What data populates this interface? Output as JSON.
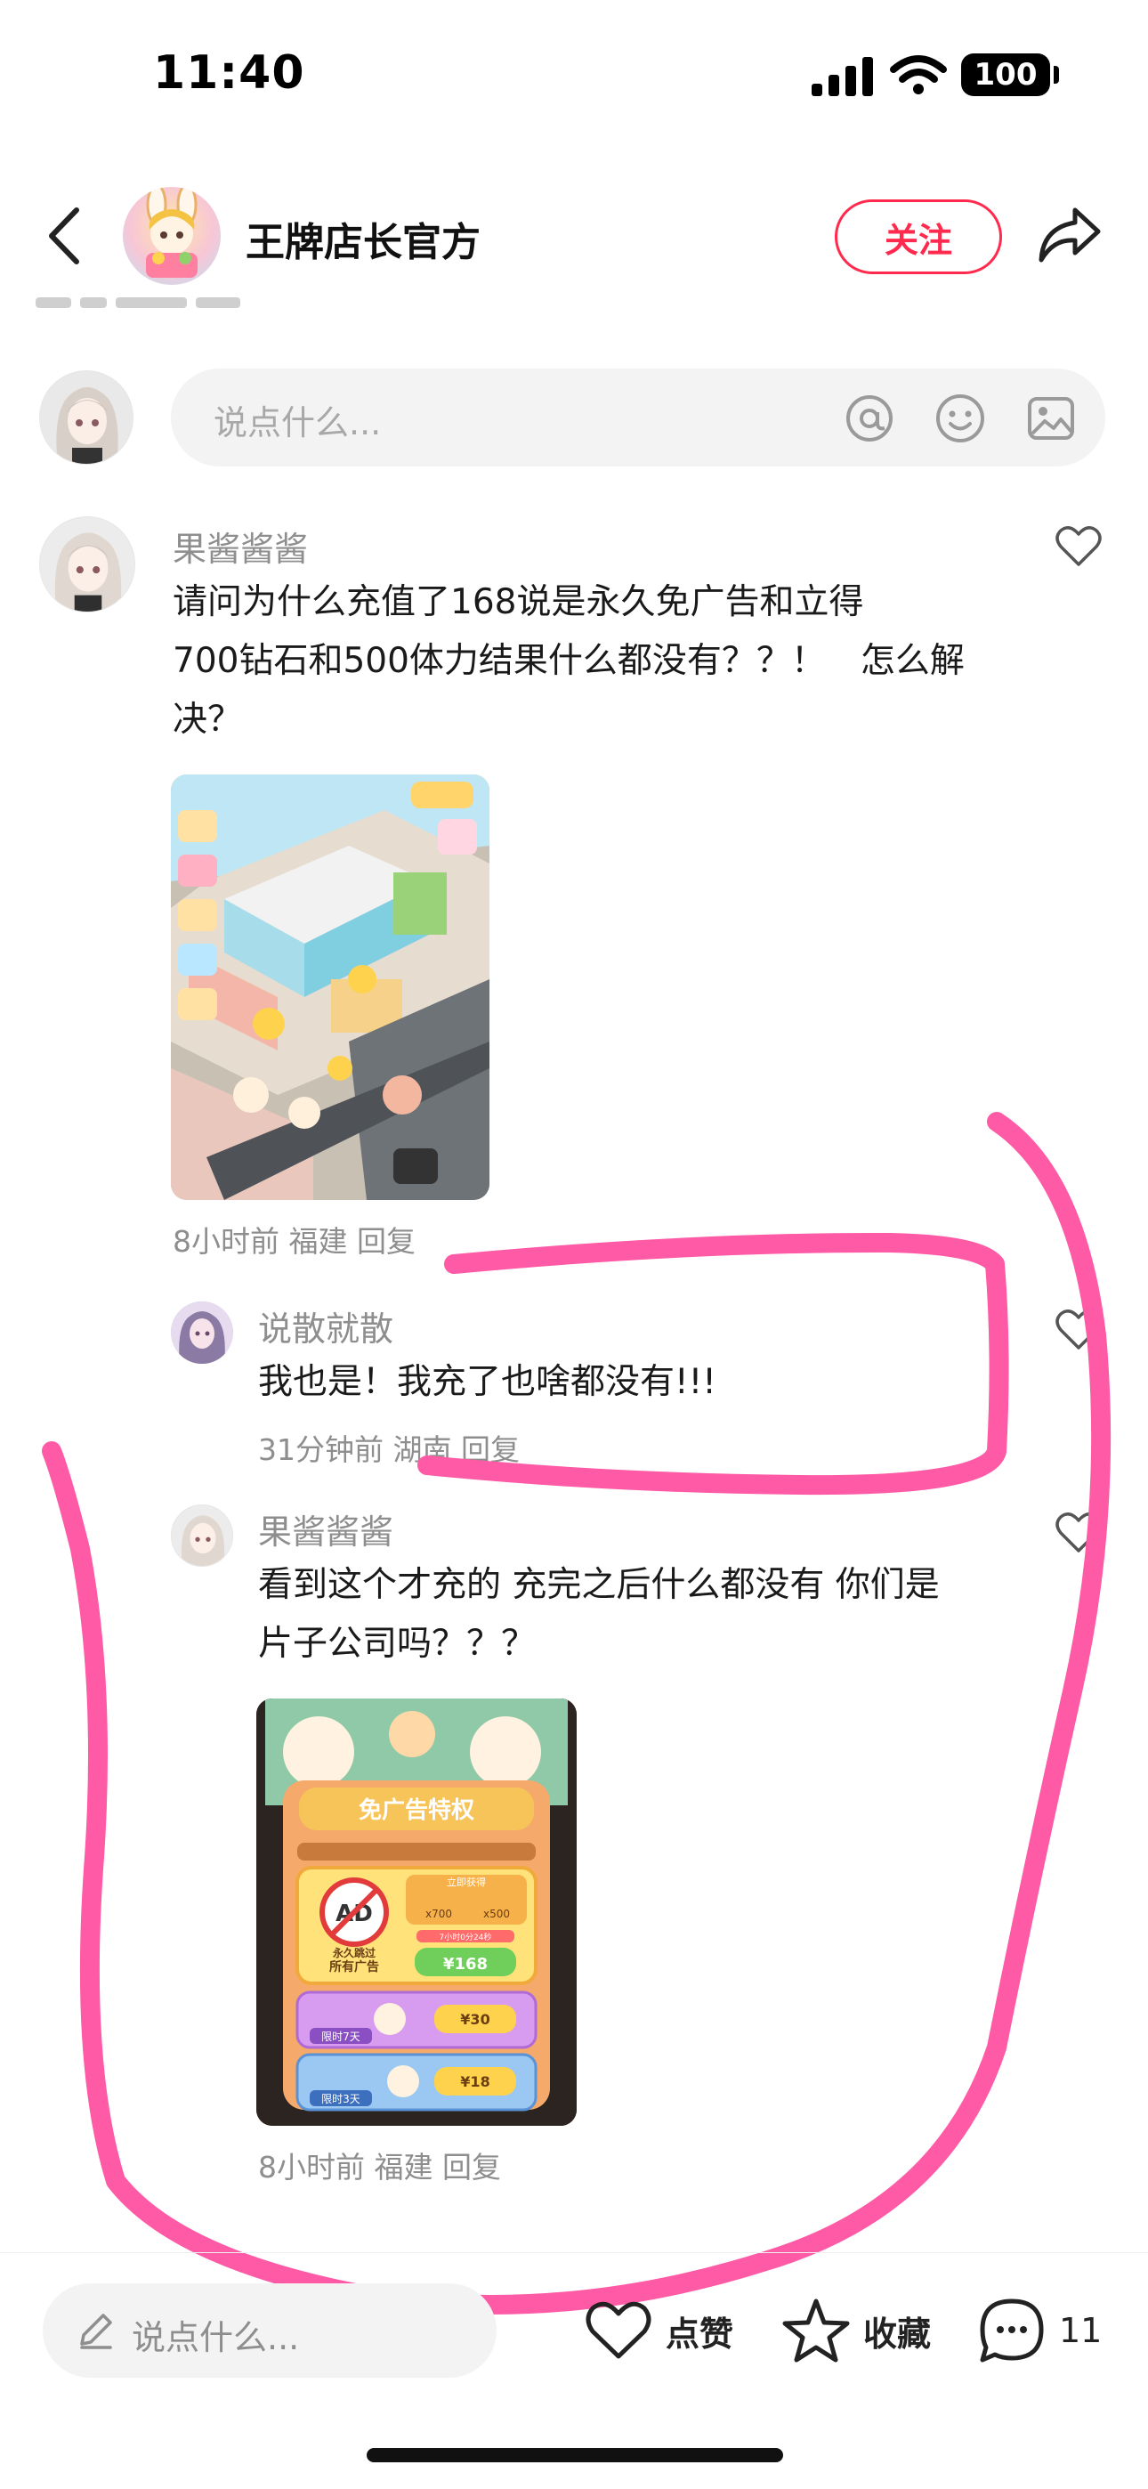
{
  "status_bar": {
    "time": "11:40",
    "battery": "100"
  },
  "header": {
    "title": "王牌店长官方",
    "follow_label": "关注"
  },
  "comment_input": {
    "placeholder": "说点什么..."
  },
  "comments": [
    {
      "name": "果酱酱酱",
      "text_lines": [
        "请问为什么充值了168说是永久免广告和立得",
        "700钻石和500体力结果什么都没有？？！　怎么解",
        "决？"
      ],
      "meta": "8小时前 福建 回复"
    },
    {
      "name": "说散就散",
      "text_lines": [
        "我也是！我充了也啥都没有!!!"
      ],
      "meta": "31分钟前 湖南 回复"
    },
    {
      "name": "果酱酱酱",
      "text_lines": [
        "看到这个才充的 充完之后什么都没有 你们是",
        "片子公司吗？？？"
      ],
      "meta": "8小时前 福建 回复",
      "shop": {
        "title": "免广告特权",
        "ad_label": "AD",
        "perm_label": "永久跳过",
        "perm_sub": "所有广告",
        "instant_label": "立即获得",
        "diamond_count": "x700",
        "energy_count": "x500",
        "timer": "7小时0分24秒",
        "price_main": "¥168",
        "tier2_tag": "限时7天",
        "tier2_price": "¥30",
        "tier3_tag": "限时3天",
        "tier3_price": "¥18"
      }
    }
  ],
  "bottom_bar": {
    "placeholder": "说点什么...",
    "like_label": "点赞",
    "collect_label": "收藏",
    "comment_count": "11"
  },
  "colors": {
    "accent": "#ff2a4d",
    "annotation": "#ff5aa5"
  },
  "icons": [
    "back-icon",
    "share-icon",
    "at-icon",
    "emoji-icon",
    "image-icon",
    "heart-icon",
    "pencil-icon",
    "star-icon",
    "chat-bubble-icon"
  ]
}
